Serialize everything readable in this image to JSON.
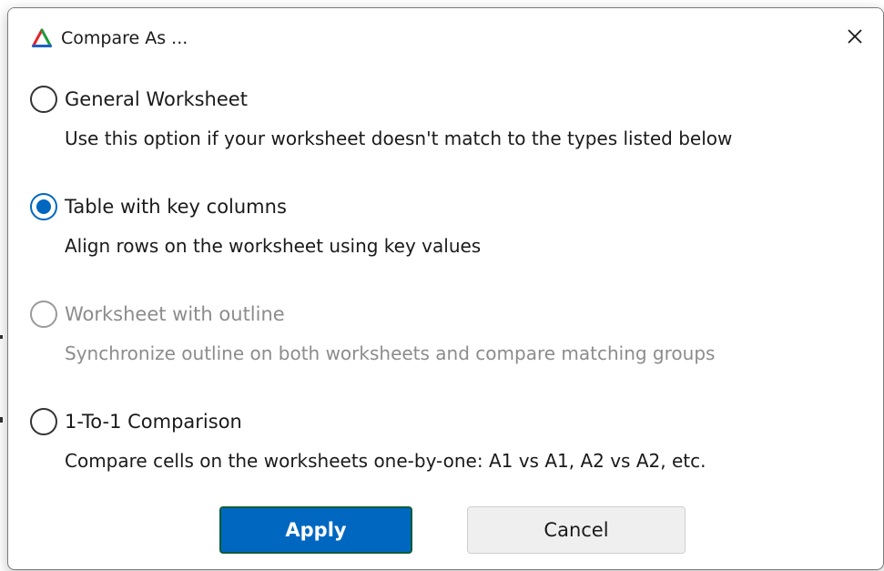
{
  "dialog": {
    "title": "Compare As ...",
    "close_glyph": "✕",
    "icon": "app-triangle-icon"
  },
  "options": [
    {
      "label": "General Worksheet",
      "description": "Use this option if your worksheet doesn't match to the types listed below",
      "checked": false,
      "enabled": true
    },
    {
      "label": "Table with key columns",
      "description": "Align rows on the worksheet using key values",
      "checked": true,
      "enabled": true
    },
    {
      "label": "Worksheet with outline",
      "description": "Synchronize outline on both worksheets and compare matching groups",
      "checked": false,
      "enabled": false
    },
    {
      "label": "1-To-1 Comparison",
      "description": "Compare cells on the worksheets one-by-one: A1 vs A1, A2 vs A2, etc.",
      "checked": false,
      "enabled": true
    }
  ],
  "buttons": {
    "apply_label": "Apply",
    "cancel_label": "Cancel"
  },
  "colors": {
    "accent": "#0067c0",
    "disabled_text": "#8c8c8c"
  }
}
